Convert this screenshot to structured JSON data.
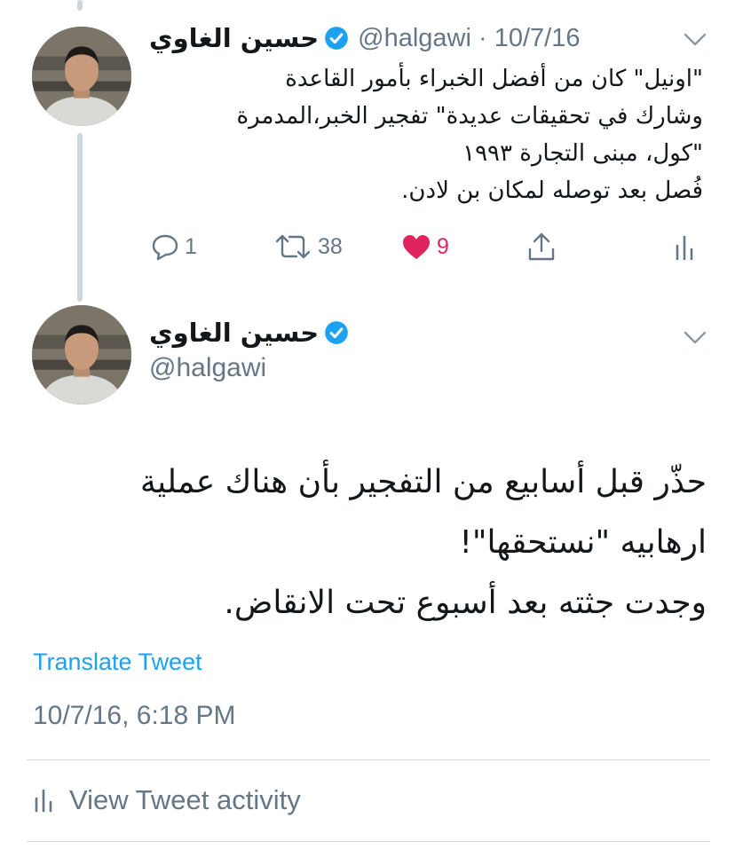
{
  "colors": {
    "text_primary": "#14171a",
    "text_secondary": "#657786",
    "link": "#1da1f2",
    "like": "#e0245e",
    "verified": "#1da1f2",
    "thread_line": "#ccd6dd"
  },
  "tweet1": {
    "author_name": "حسين الغاوي",
    "handle_date": "@halgawi · 10/7/16",
    "text_lines": [
      "\"اونيل\" كان من أفضل الخبراء بأمور القاعدة",
      "وشارك في تحقيقات عديدة\" تفجير الخبر،المدمرة",
      "\"كول، مبنى التجارة ١٩٩٣",
      "فُصل بعد توصله لمكان بن لادن."
    ],
    "actions": {
      "reply_count": "1",
      "retweet_count": "38",
      "like_count": "9",
      "icons": [
        "reply-icon",
        "retweet-icon",
        "heart-icon",
        "share-icon",
        "analytics-icon"
      ]
    }
  },
  "tweet2": {
    "author_name": "حسين الغاوي",
    "handle": "@halgawi",
    "text_lines": [
      "حذّر قبل أسابيع من التفجير بأن هناك عملية",
      "ارهابيه \"نستحقها\"!",
      "وجدت جثته بعد أسبوع تحت الانقاض."
    ],
    "translate_label": "Translate Tweet",
    "timestamp": "10/7/16, 6:18 PM",
    "activity_label": "View Tweet activity"
  }
}
